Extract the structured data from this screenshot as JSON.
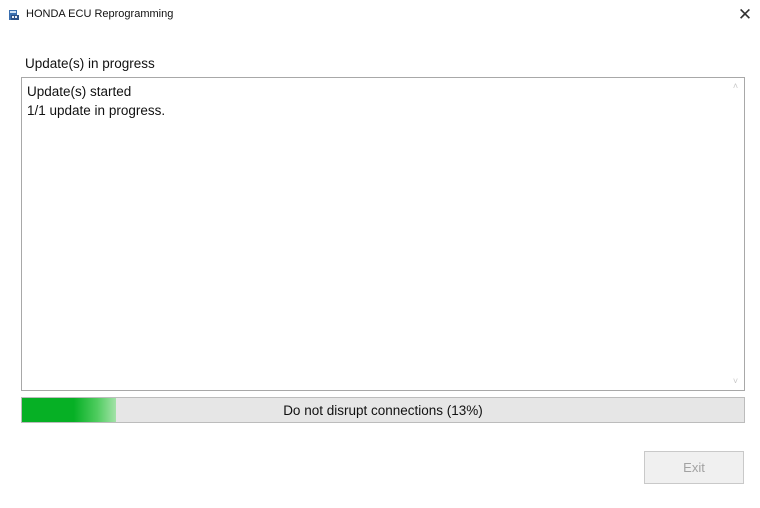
{
  "window": {
    "title": "HONDA ECU Reprogramming",
    "close_glyph": "✕",
    "icon": "honda-ecu-app-icon"
  },
  "section": {
    "label": "Update(s) in progress"
  },
  "log": {
    "lines": [
      "Update(s) started",
      "1/1 update in progress."
    ],
    "scroll_up_glyph": "˄",
    "scroll_down_glyph": "˅"
  },
  "progress": {
    "percent": 13,
    "label": "Do not disrupt connections (13%)",
    "fill_color": "#06b025"
  },
  "buttons": {
    "exit_label": "Exit",
    "exit_enabled": false
  }
}
